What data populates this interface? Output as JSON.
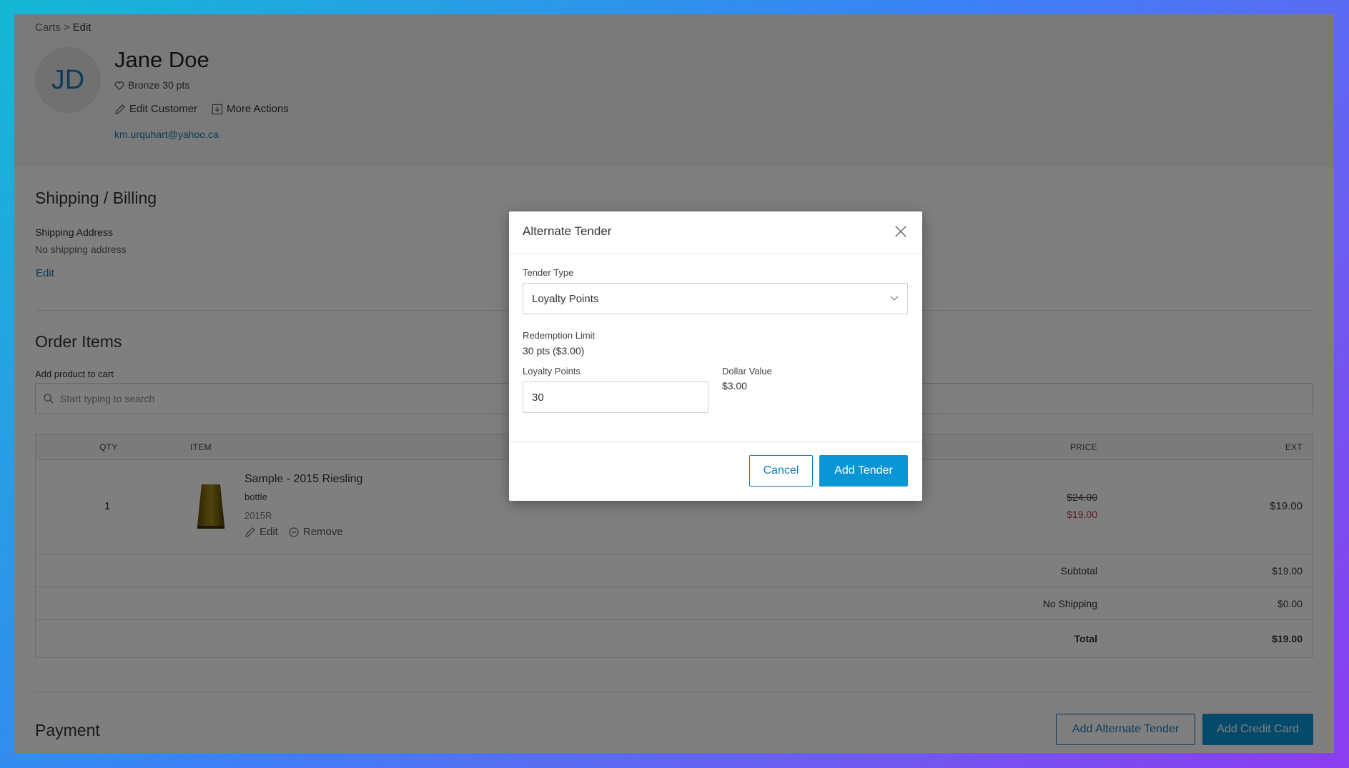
{
  "breadcrumb": {
    "parent": "Carts",
    "separator": ">",
    "current": "Edit"
  },
  "customer": {
    "initials": "JD",
    "name": "Jane Doe",
    "tier": "Bronze 30 pts",
    "edit_label": "Edit Customer",
    "more_actions_label": "More Actions",
    "email": "km.urquhart@yahoo.ca"
  },
  "shipping": {
    "title": "Shipping / Billing",
    "address_label": "Shipping Address",
    "address_value": "No shipping address",
    "edit_label": "Edit"
  },
  "order": {
    "title": "Order Items",
    "add_label": "Add product to cart",
    "search_placeholder": "Start typing to search",
    "columns": {
      "qty": "QTY",
      "item": "ITEM",
      "price": "PRICE",
      "ext": "EXT"
    },
    "items": [
      {
        "qty": "1",
        "name": "Sample - 2015 Riesling",
        "unit": "bottle",
        "sku": "2015R",
        "edit_label": "Edit",
        "remove_label": "Remove",
        "price_original": "$24.00",
        "price_sale": "$19.00",
        "ext": "$19.00"
      }
    ],
    "subtotal_label": "Subtotal",
    "subtotal": "$19.00",
    "shipping_label": "No Shipping",
    "shipping_value": "$0.00",
    "total_label": "Total",
    "total": "$19.00"
  },
  "payment": {
    "title": "Payment",
    "alt_tender_label": "Add Alternate Tender",
    "credit_card_label": "Add Credit Card"
  },
  "modal": {
    "title": "Alternate Tender",
    "tender_type_label": "Tender Type",
    "tender_type_value": "Loyalty Points",
    "redemption_label": "Redemption Limit",
    "redemption_value": "30 pts ($3.00)",
    "points_label": "Loyalty Points",
    "points_value": "30",
    "dollar_label": "Dollar Value",
    "dollar_value": "$3.00",
    "cancel_label": "Cancel",
    "submit_label": "Add Tender"
  },
  "colors": {
    "accent": "#0a95d4",
    "link": "#1a78b4",
    "sale_price": "#c23a3a"
  }
}
